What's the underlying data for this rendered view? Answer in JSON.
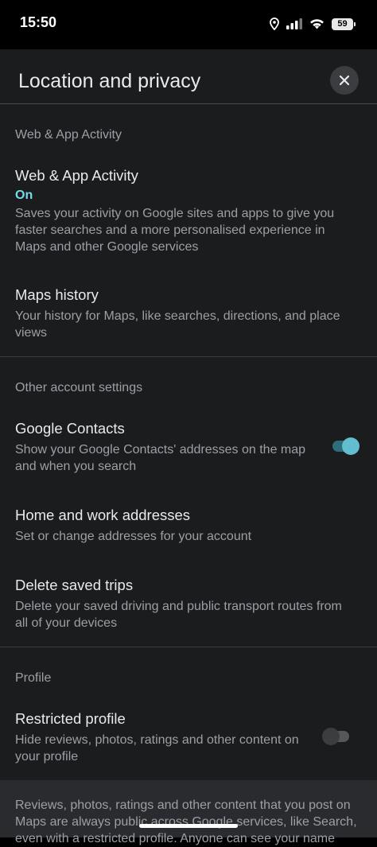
{
  "status_bar": {
    "time": "15:50",
    "battery": "59"
  },
  "header": {
    "title": "Location and privacy"
  },
  "sections": {
    "web_app": {
      "header": "Web & App Activity",
      "activity": {
        "title": "Web & App Activity",
        "status": "On",
        "subtitle": "Saves your activity on Google sites and apps to give you faster searches and a more personalised experience in Maps and other Google services"
      },
      "maps_history": {
        "title": "Maps history",
        "subtitle": "Your history for Maps, like searches, directions, and place views"
      }
    },
    "other": {
      "header": "Other account settings",
      "contacts": {
        "title": "Google Contacts",
        "subtitle": "Show your Google Contacts' addresses on the map and when you search",
        "toggle_on": true
      },
      "home_work": {
        "title": "Home and work addresses",
        "subtitle": "Set or change addresses for your account"
      },
      "delete_trips": {
        "title": "Delete saved trips",
        "subtitle": "Delete your saved driving and public transport routes from all of your devices"
      }
    },
    "profile": {
      "header": "Profile",
      "restricted": {
        "title": "Restricted profile",
        "subtitle": "Hide reviews, photos, ratings and other content on your profile",
        "toggle_on": false
      }
    }
  },
  "footer": {
    "text": "Reviews, photos, ratings and other content that you post on Maps are always public across Google services, like Search, even with a restricted profile. Anyone can see your name"
  },
  "colors": {
    "accent": "#78d9ec",
    "toggle_on": "#62bdcf",
    "sheet_bg": "#1b1c1e"
  }
}
